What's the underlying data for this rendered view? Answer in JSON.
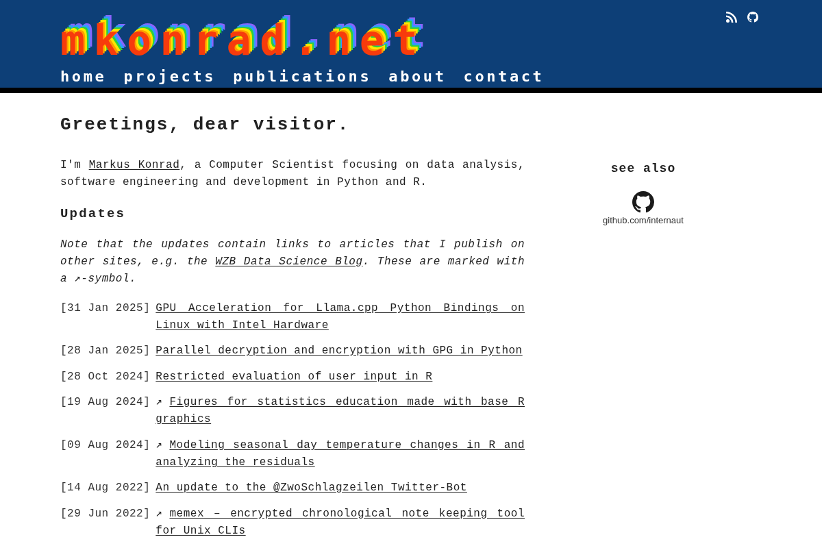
{
  "header": {
    "logo": "mkonrad.net",
    "nav": [
      {
        "label": "home"
      },
      {
        "label": "projects"
      },
      {
        "label": "publications"
      },
      {
        "label": "about"
      },
      {
        "label": "contact"
      }
    ]
  },
  "intro": {
    "title": "Greetings, dear visitor.",
    "paragraph": {
      "before": "I'm ",
      "link": "Markus Konrad",
      "after": ", a Computer Scientist focusing on data analysis, software engineering and development in Python and R."
    }
  },
  "updates": {
    "title": "Updates",
    "note": {
      "before": "Note that the updates contain links to articles that I publish on other sites, e.g. the ",
      "link": "WZB Data Science Blog",
      "after": ". These are marked with a ↗-symbol."
    },
    "items": [
      {
        "date": "[31 Jan 2025]",
        "title": "GPU Acceleration for Llama.cpp Python Bindings on Linux with Intel Hardware"
      },
      {
        "date": "[28 Jan 2025]",
        "title": "Parallel decryption and encryption with GPG in Python"
      },
      {
        "date": "[28 Oct 2024]",
        "title": "Restricted evaluation of user input in R"
      },
      {
        "date": "[19 Aug 2024]",
        "marker": "↗",
        "title": "Figures for statistics education made with base R graphics"
      },
      {
        "date": "[09 Aug 2024]",
        "marker": "↗",
        "title": "Modeling seasonal day temperature changes in R and analyzing the residuals"
      },
      {
        "date": "[14 Aug 2022]",
        "title": "An update to the @ZwoSchlagzeilen Twitter-Bot"
      },
      {
        "date": "[29 Jun 2022]",
        "marker": "↗",
        "title": "memex – encrypted chronological note keeping tool for Unix CLIs"
      }
    ]
  },
  "see_also": {
    "title": "see also",
    "links": [
      {
        "label": "github.com/internaut"
      }
    ]
  }
}
